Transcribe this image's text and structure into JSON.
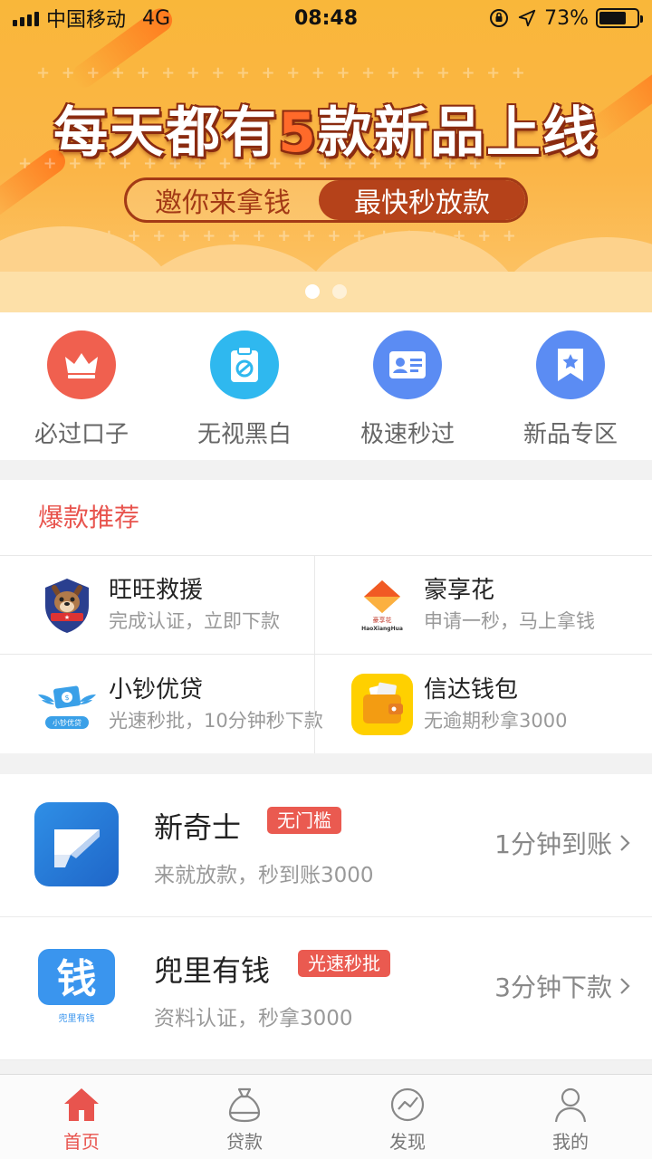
{
  "status_bar": {
    "carrier": "中国移动",
    "network": "4G",
    "time": "08:48",
    "battery": "73%",
    "battery_level": 0.73
  },
  "banner": {
    "headline_pre": "每天都有",
    "headline_num": "5",
    "headline_post": "款新品上线",
    "pill_left": "邀你来拿钱",
    "pill_right": "最快秒放款",
    "page_count": 2,
    "active_page": 1
  },
  "quick_links": [
    {
      "label": "必过口子",
      "icon": "crown-icon",
      "color": "#f0604f"
    },
    {
      "label": "无视黑白",
      "icon": "clipboard-icon",
      "color": "#2fb8ef"
    },
    {
      "label": "极速秒过",
      "icon": "id-card-icon",
      "color": "#5b8cf3"
    },
    {
      "label": "新品专区",
      "icon": "bookmark-star-icon",
      "color": "#5b8cf3"
    }
  ],
  "hot": {
    "title": "爆款推荐",
    "items": [
      {
        "name": "旺旺救援",
        "desc": "完成认证，立即下款",
        "logo": "dog-badge-logo"
      },
      {
        "name": "豪享花",
        "desc": "申请一秒，马上拿钱",
        "logo": "haoxianghua-logo",
        "logo_small_text": "豪享花",
        "logo_latin": "HaoXiangHua"
      },
      {
        "name": "小钞优贷",
        "desc": "光速秒批，10分钟秒下款",
        "logo": "winged-money-logo",
        "logo_small_text": "小钞优贷"
      },
      {
        "name": "信达钱包",
        "desc": "无逾期秒拿3000",
        "logo": "wallet-logo"
      }
    ]
  },
  "products": [
    {
      "name": "新奇士",
      "tag": "无门槛",
      "desc": "来就放款，秒到账3000",
      "speed": "1分钟到账",
      "icon": "xinqishi-app-icon"
    },
    {
      "name": "兜里有钱",
      "tag": "光速秒批",
      "desc": "资料认证，秒拿3000",
      "speed": "3分钟下款",
      "icon": "doulitouqian-app-icon",
      "icon_glyph": "钱",
      "icon_caption": "兜里有钱"
    }
  ],
  "tabbar": [
    {
      "label": "首页",
      "icon": "home-icon",
      "active": true
    },
    {
      "label": "贷款",
      "icon": "money-bag-icon",
      "active": false
    },
    {
      "label": "发现",
      "icon": "discover-icon",
      "active": false
    },
    {
      "label": "我的",
      "icon": "user-icon",
      "active": false
    }
  ],
  "colors": {
    "accent": "#e8544e",
    "tag": "#ea5a50",
    "banner": "#f9b73a"
  }
}
